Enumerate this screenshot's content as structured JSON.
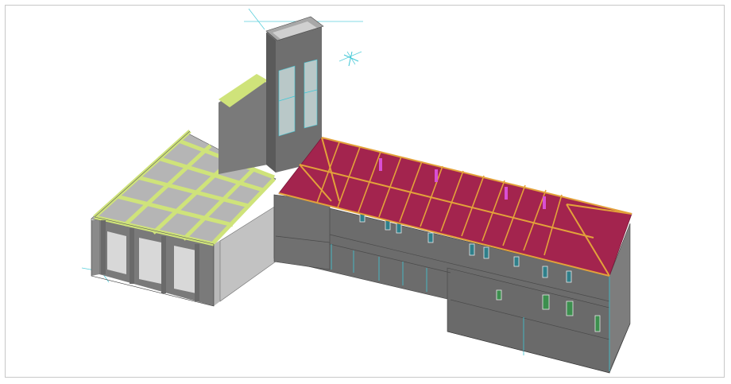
{
  "viewport": {
    "background": "#ffffff",
    "border_color": "#c8c8c8"
  },
  "model": {
    "colors": {
      "wall": "#6f6f6f",
      "wall_dark": "#5c5c5c",
      "wall_light": "#9a9a9a",
      "slab_top": "#c9c9c9",
      "beam_top": "#cfe37a",
      "roof_deck": "#a3244e",
      "roof_rafter": "#e3a23a",
      "roof_accent": "#d94fd4",
      "window": "#2f7f8a",
      "window_green": "#3c8f4e",
      "axis_lines": "#3fc7d6"
    },
    "icons": [
      "view-axis-icon"
    ]
  }
}
